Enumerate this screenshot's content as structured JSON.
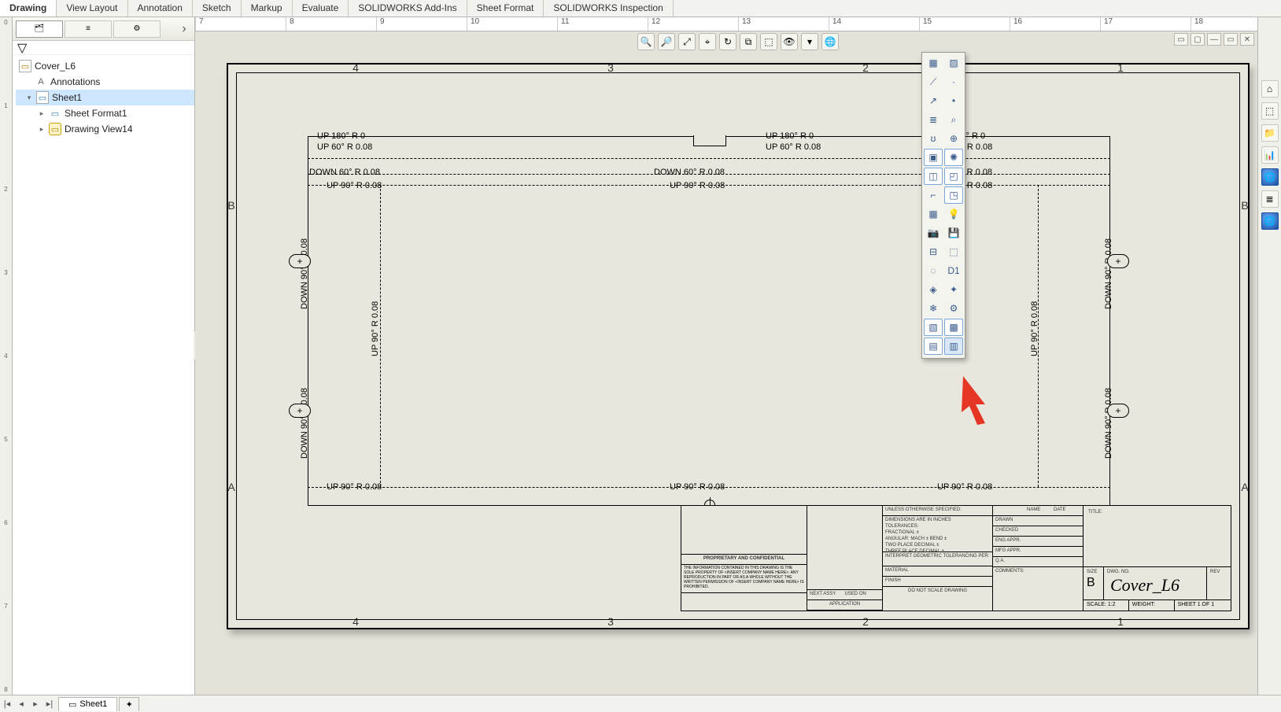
{
  "cmdTabs": [
    "Drawing",
    "View Layout",
    "Annotation",
    "Sketch",
    "Markup",
    "Evaluate",
    "SOLIDWORKS Add-Ins",
    "Sheet Format",
    "SOLIDWORKS Inspection"
  ],
  "activeCmdTab": 0,
  "rulerStart": 7,
  "rulerEnd": 18,
  "tree": {
    "root": "Cover_L6",
    "annotations": "Annotations",
    "sheet": "Sheet1",
    "format": "Sheet Format1",
    "view": "Drawing View14"
  },
  "zonesTop": [
    "4",
    "3",
    "2",
    "1"
  ],
  "zonesSide": [
    "B",
    "A"
  ],
  "bendNotes": {
    "up180": "UP  180°  R 0",
    "up60": "UP  60°  R 0.08",
    "dn60": "DOWN  60°  R 0.08",
    "up90": "UP  90°  R 0.08",
    "dn90": "DOWN  90°  R 0.08"
  },
  "hudIcons": [
    "🔍",
    "🔎",
    "⤢",
    "⌖",
    "↻",
    "⧉",
    "⬚",
    "👁",
    "▾",
    "🌐"
  ],
  "flyoutRows": [
    [
      "▦",
      "▨"
    ],
    [
      "⟋",
      "·"
    ],
    [
      "↗",
      "•"
    ],
    [
      "≣",
      "⌕"
    ],
    [
      "ʊ",
      "⊕"
    ],
    [
      "▣",
      "✺"
    ],
    [
      "◫",
      "◰"
    ],
    [
      "⌐",
      "◳"
    ],
    [
      "▦",
      "💡"
    ],
    [
      "📷",
      "💾"
    ],
    [
      "⊟",
      "⬚"
    ],
    [
      "◌",
      "D1"
    ],
    [
      "◈",
      "✦"
    ],
    [
      "❄",
      "⚙"
    ],
    [
      "▧",
      "▩"
    ],
    [
      "▤",
      "▥"
    ]
  ],
  "flyoutActive": [
    [
      5,
      0
    ],
    [
      5,
      1
    ],
    [
      6,
      0
    ],
    [
      6,
      1
    ],
    [
      7,
      1
    ],
    [
      14,
      0
    ],
    [
      14,
      1
    ],
    [
      15,
      0
    ]
  ],
  "flyoutHighlight": [
    15,
    1
  ],
  "winBtns": [
    "▭",
    "▢",
    "—",
    "▭",
    "✕"
  ],
  "taskIcons": [
    "⌂",
    "⬚",
    "📁",
    "📊",
    "🌐",
    "≣",
    "🌐"
  ],
  "sheetTab": "Sheet1",
  "titleBlock": {
    "confidential": "PROPRIETARY AND CONFIDENTIAL",
    "confText": "THE INFORMATION CONTAINED IN THIS DRAWING IS THE SOLE PROPERTY OF <INSERT COMPANY NAME HERE>.  ANY REPRODUCTION IN PART OR AS A WHOLE WITHOUT THE WRITTEN PERMISSION OF <INSERT COMPANY NAME HERE> IS PROHIBITED.",
    "nextAssy": "NEXT ASSY",
    "usedOn": "USED ON",
    "application": "APPLICATION",
    "unless": "UNLESS OTHERWISE SPECIFIED:",
    "dims": "DIMENSIONS ARE IN INCHES",
    "tols": "TOLERANCES:",
    "frac": "FRACTIONAL ±",
    "ang": "ANGULAR: MACH ±    BEND ±",
    "two": "TWO PLACE DECIMAL    ±",
    "three": "THREE PLACE DECIMAL  ±",
    "geo": "INTERPRET GEOMETRIC TOLERANCING PER:",
    "mat": "MATERIAL",
    "fin": "FINISH",
    "dns": "DO NOT SCALE DRAWING",
    "name": "NAME",
    "date": "DATE",
    "drawn": "DRAWN",
    "checked": "CHECKED",
    "engappr": "ENG APPR.",
    "mfgappr": "MFG APPR.",
    "qa": "Q.A.",
    "comments": "COMMENTS:",
    "title": "TITLE:",
    "size": "SIZE",
    "sizeVal": "B",
    "dwgno": "DWG.  NO.",
    "dwgVal": "Cover_L6",
    "rev": "REV",
    "scale": "SCALE: 1:2",
    "weight": "WEIGHT:",
    "sheet": "SHEET 1 OF 1"
  }
}
